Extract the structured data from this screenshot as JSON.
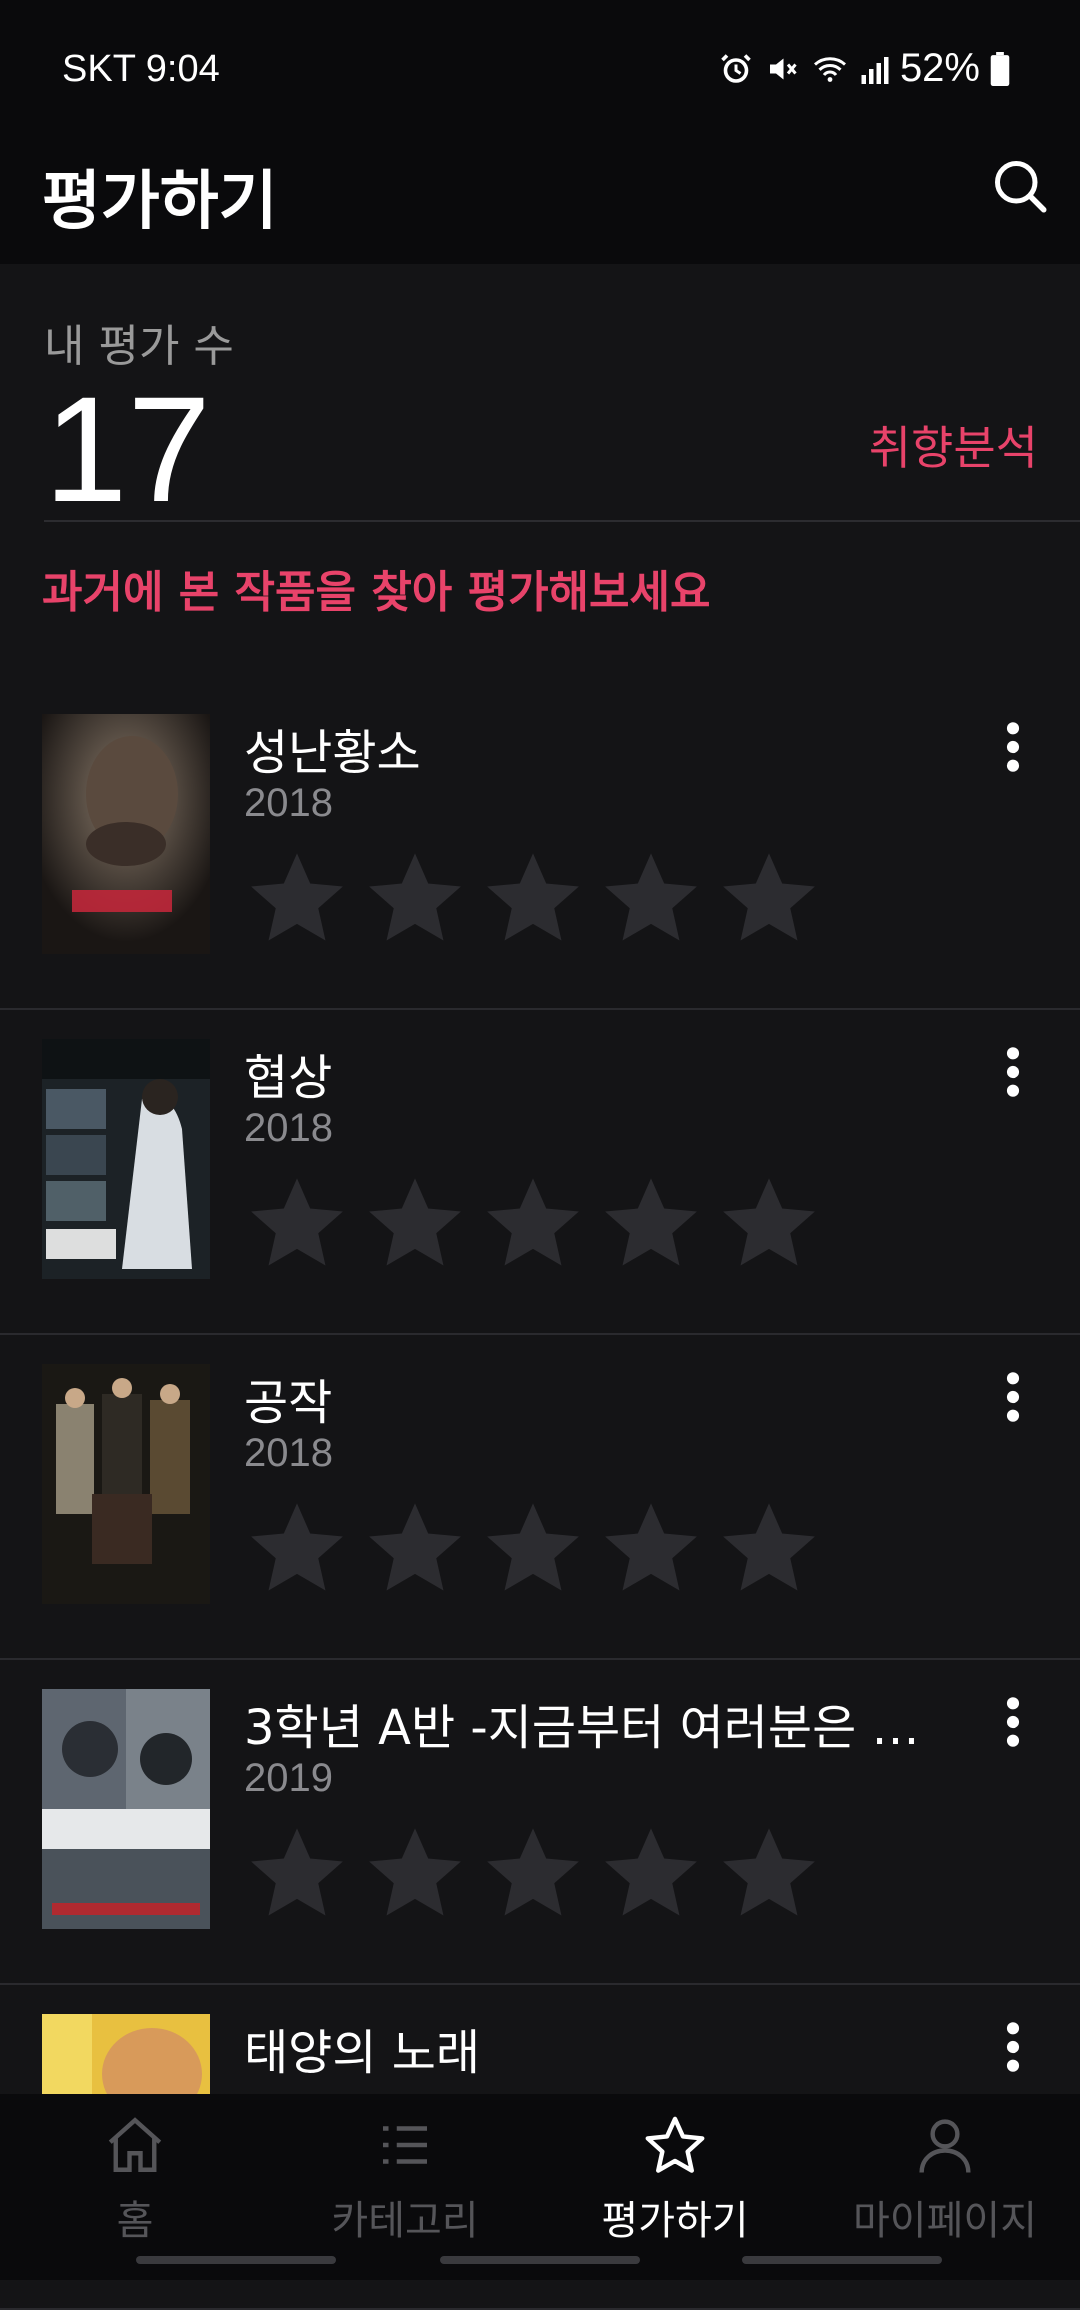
{
  "status_bar": {
    "carrier_time": "SKT 9:04",
    "battery": "52%"
  },
  "header": {
    "title": "평가하기",
    "search_icon": "search-icon"
  },
  "summary": {
    "label": "내 평가 수",
    "count": "17",
    "analysis_link": "취향분석"
  },
  "prompt": "과거에 본 작품을 찾아 평가해보세요",
  "items": [
    {
      "title": "성난황소",
      "year": "2018",
      "rating": 0
    },
    {
      "title": "협상",
      "year": "2018",
      "rating": 0
    },
    {
      "title": "공작",
      "year": "2018",
      "rating": 0
    },
    {
      "title": "3학년 A반 -지금부터 여러분은 인…",
      "year": "2019",
      "rating": 0
    },
    {
      "title": "태양의 노래",
      "year": "",
      "rating": 0
    }
  ],
  "nav": [
    {
      "label": "홈",
      "icon": "home-icon",
      "active": false
    },
    {
      "label": "카테고리",
      "icon": "list-icon",
      "active": false
    },
    {
      "label": "평가하기",
      "icon": "star-icon",
      "active": true
    },
    {
      "label": "마이페이지",
      "icon": "person-icon",
      "active": false
    }
  ],
  "colors": {
    "accent": "#e8436a",
    "background": "#141416",
    "star_empty": "#2c2c30"
  }
}
